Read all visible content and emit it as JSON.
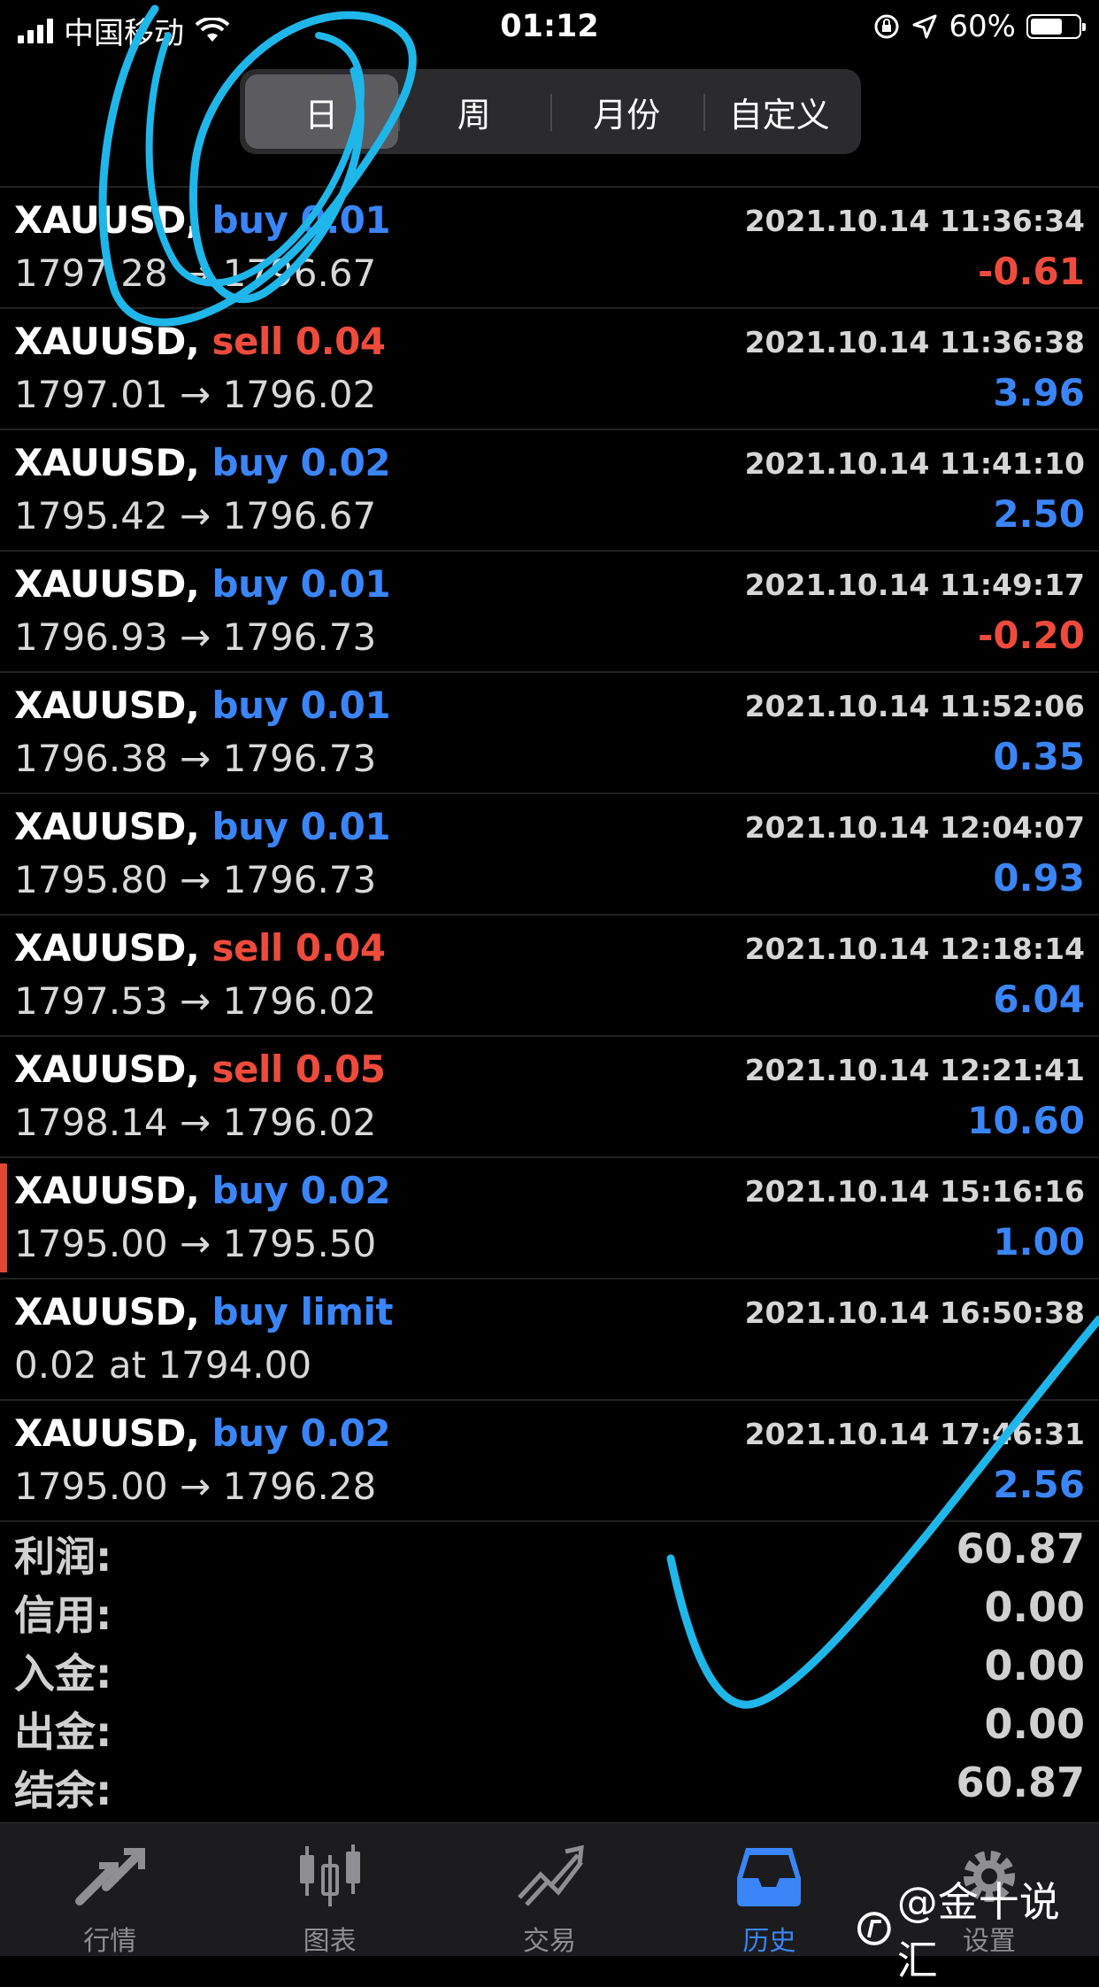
{
  "status_bar": {
    "carrier": "中国移动",
    "time": "01:12",
    "battery": "60%"
  },
  "period_tabs": [
    {
      "label": "日",
      "active": true
    },
    {
      "label": "周",
      "active": false
    },
    {
      "label": "月份",
      "active": false
    },
    {
      "label": "自定义",
      "active": false
    }
  ],
  "trades": [
    {
      "symbol": "XAUUSD,",
      "side": "buy 0.01",
      "side_color": "#3a85f7",
      "price": "1797.28 → 1796.67",
      "time": "2021.10.14 11:36:34",
      "profit": "-0.61",
      "profit_color": "#ee4b3c"
    },
    {
      "symbol": "XAUUSD,",
      "side": "sell 0.04",
      "side_color": "#ee4b3c",
      "price": "1797.01 → 1796.02",
      "time": "2021.10.14 11:36:38",
      "profit": "3.96",
      "profit_color": "#3a85f7"
    },
    {
      "symbol": "XAUUSD,",
      "side": "buy 0.02",
      "side_color": "#3a85f7",
      "price": "1795.42 → 1796.67",
      "time": "2021.10.14 11:41:10",
      "profit": "2.50",
      "profit_color": "#3a85f7"
    },
    {
      "symbol": "XAUUSD,",
      "side": "buy 0.01",
      "side_color": "#3a85f7",
      "price": "1796.93 → 1796.73",
      "time": "2021.10.14 11:49:17",
      "profit": "-0.20",
      "profit_color": "#ee4b3c"
    },
    {
      "symbol": "XAUUSD,",
      "side": "buy 0.01",
      "side_color": "#3a85f7",
      "price": "1796.38 → 1796.73",
      "time": "2021.10.14 11:52:06",
      "profit": "0.35",
      "profit_color": "#3a85f7"
    },
    {
      "symbol": "XAUUSD,",
      "side": "buy 0.01",
      "side_color": "#3a85f7",
      "price": "1795.80 → 1796.73",
      "time": "2021.10.14 12:04:07",
      "profit": "0.93",
      "profit_color": "#3a85f7"
    },
    {
      "symbol": "XAUUSD,",
      "side": "sell 0.04",
      "side_color": "#ee4b3c",
      "price": "1797.53 → 1796.02",
      "time": "2021.10.14 12:18:14",
      "profit": "6.04",
      "profit_color": "#3a85f7"
    },
    {
      "symbol": "XAUUSD,",
      "side": "sell 0.05",
      "side_color": "#ee4b3c",
      "price": "1798.14 → 1796.02",
      "time": "2021.10.14 12:21:41",
      "profit": "10.60",
      "profit_color": "#3a85f7"
    },
    {
      "symbol": "XAUUSD,",
      "side": "buy 0.02",
      "side_color": "#3a85f7",
      "price": "1795.00 → 1795.50",
      "time": "2021.10.14 15:16:16",
      "profit": "1.00",
      "profit_color": "#3a85f7"
    },
    {
      "symbol": "XAUUSD,",
      "side": "buy limit",
      "side_color": "#3a85f7",
      "price": "0.02 at 1794.00",
      "time": "2021.10.14 16:50:38",
      "profit": "",
      "profit_color": "#3a85f7"
    },
    {
      "symbol": "XAUUSD,",
      "side": "buy 0.02",
      "side_color": "#3a85f7",
      "price": "1795.00 → 1796.28",
      "time": "2021.10.14 17:46:31",
      "profit": "2.56",
      "profit_color": "#3a85f7"
    }
  ],
  "summary": [
    {
      "label": "利润:",
      "value": "60.87"
    },
    {
      "label": "信用:",
      "value": "0.00"
    },
    {
      "label": "入金:",
      "value": "0.00"
    },
    {
      "label": "出金:",
      "value": "0.00"
    },
    {
      "label": "结余:",
      "value": "60.87"
    }
  ],
  "tab_bar": [
    {
      "label": "行情",
      "icon": "quotes-arrows-icon",
      "active": false
    },
    {
      "label": "图表",
      "icon": "candlestick-chart-icon",
      "active": false
    },
    {
      "label": "交易",
      "icon": "trade-trend-icon",
      "active": false
    },
    {
      "label": "历史",
      "icon": "history-inbox-icon",
      "active": true
    },
    {
      "label": "设置",
      "icon": "gear-icon",
      "active": false
    }
  ],
  "watermark": "@金十说汇",
  "colors": {
    "buy_blue": "#3a85f7",
    "sell_red": "#ee4b3c",
    "annotation_cyan": "#1fb6ea",
    "marker_red": "#e0472f"
  }
}
